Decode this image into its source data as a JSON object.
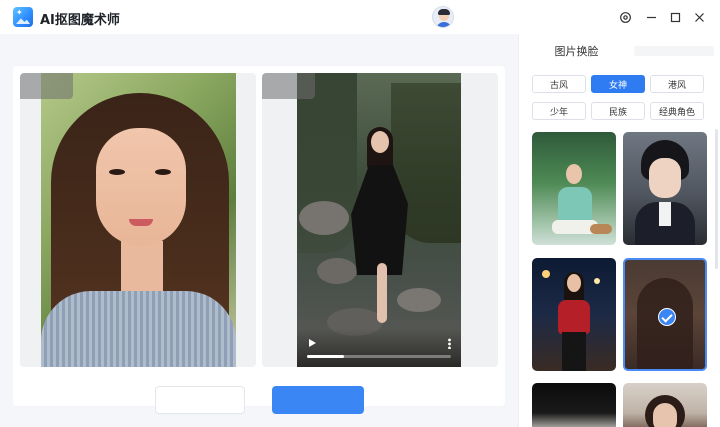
{
  "app": {
    "title": "AI抠图魔术师"
  },
  "sidebar": {
    "title": "图片换脸",
    "tags": [
      "古风",
      "女神",
      "港风",
      "少年",
      "民族",
      "经典角色"
    ],
    "active_tag": "女神"
  },
  "video": {
    "progress": 0.26
  },
  "colors": {
    "accent": "#3b86f5",
    "background": "#f4f6f9"
  }
}
